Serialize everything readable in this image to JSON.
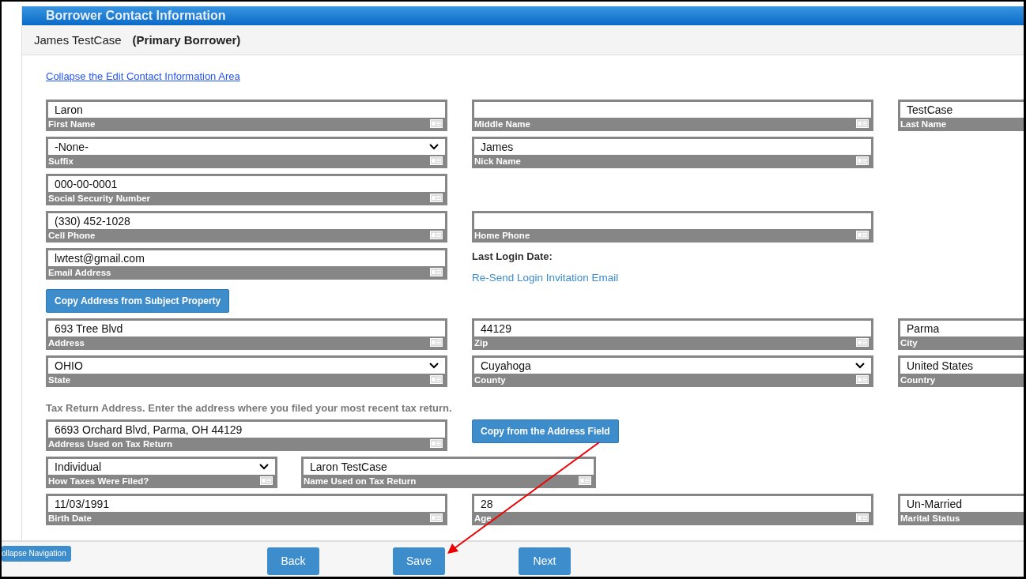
{
  "header": {
    "title": "Borrower Contact Information"
  },
  "borrower": {
    "name": "James TestCase",
    "role": "(Primary Borrower)"
  },
  "collapse_link": "Collapse the Edit Contact Information Area",
  "rows": [
    {
      "cells": [
        {
          "kind": "text",
          "label": "First Name",
          "value": "Laron"
        },
        {
          "kind": "text",
          "label": "Middle Name"
        },
        {
          "kind": "text",
          "label": "Last Name",
          "value": "TestCase"
        }
      ]
    },
    {
      "cells": [
        {
          "kind": "select",
          "label": "Suffix",
          "value": "-None-"
        },
        {
          "kind": "text",
          "label": "Nick Name",
          "value": "James"
        }
      ]
    },
    {
      "cells": [
        {
          "kind": "text",
          "label": "Social Security Number",
          "value": "000-00-0001"
        }
      ]
    },
    {
      "cells": [
        {
          "kind": "text",
          "label": "Cell Phone",
          "value": "(330) 452-1028"
        },
        {
          "kind": "text",
          "label": "Home Phone"
        }
      ]
    },
    {
      "cells": [
        {
          "kind": "text",
          "label": "Email Address",
          "value": "lwtest@gmail.com"
        },
        {
          "kind": "login",
          "label": "Last Login Date:",
          "link": "Re-Send Login Invitation Email"
        }
      ]
    },
    {
      "cells": [
        {
          "kind": "button",
          "label": "Copy Address from Subject Property"
        }
      ]
    },
    {
      "cells": [
        {
          "kind": "text",
          "label": "Address",
          "value": "693 Tree Blvd"
        },
        {
          "kind": "text",
          "label": "Zip",
          "value": "44129"
        },
        {
          "kind": "text",
          "label": "City",
          "value": "Parma"
        }
      ]
    },
    {
      "cells": [
        {
          "kind": "select",
          "label": "State",
          "value": "OHIO"
        },
        {
          "kind": "select",
          "label": "County",
          "value": "Cuyahoga"
        },
        {
          "kind": "text",
          "label": "Country",
          "value": "United States"
        }
      ]
    },
    {
      "cells": [
        {
          "kind": "note",
          "label": "Tax Return Address. Enter the address where you filed your most recent tax return."
        }
      ]
    },
    {
      "cells": [
        {
          "kind": "text",
          "label": "Address Used on Tax Return",
          "value": "6693 Orchard Blvd, Parma, OH 44129"
        },
        {
          "kind": "button",
          "label": "Copy from the Address Field"
        }
      ]
    },
    {
      "compact": true,
      "cells": [
        {
          "kind": "select",
          "label": "How Taxes Were Filed?",
          "value": "Individual"
        },
        {
          "kind": "text",
          "label": "Name Used on Tax Return",
          "value": "Laron TestCase"
        }
      ]
    },
    {
      "cells": [
        {
          "kind": "text",
          "label": "Birth Date",
          "value": "11/03/1991"
        },
        {
          "kind": "text",
          "label": "Age",
          "value": "28"
        },
        {
          "kind": "text",
          "label": "Marital Status",
          "value": "Un-Married"
        }
      ]
    }
  ],
  "footer": {
    "collapse_nav": "ollapse Navigation",
    "buttons": [
      "Back",
      "Save",
      "Next"
    ]
  }
}
